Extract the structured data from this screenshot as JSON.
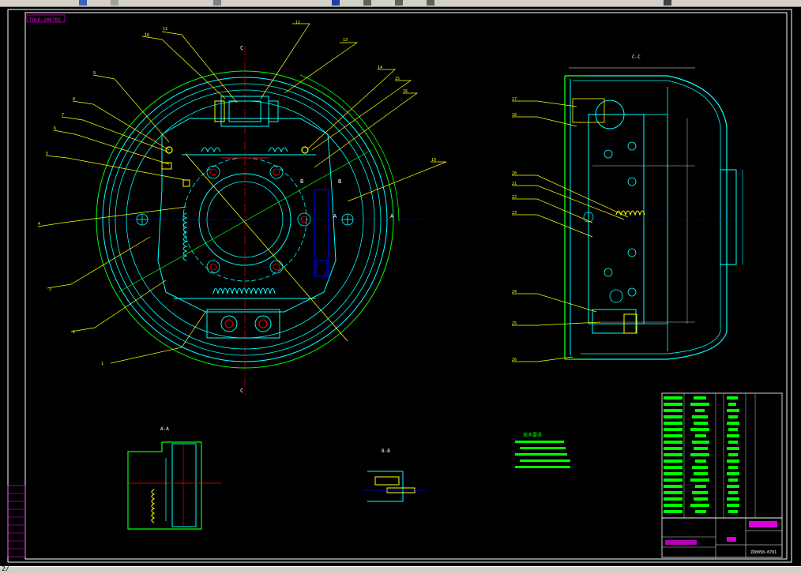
{
  "drawing": {
    "sheet_code": "TOLE-200702",
    "view_labels": {
      "section_cc": "C-C",
      "section_aa": "A-A",
      "section_bb": "B-B"
    },
    "section_marks": [
      "A",
      "A",
      "B",
      "B",
      "C",
      "C"
    ],
    "callouts_front": [
      "1",
      "2",
      "3",
      "4",
      "5",
      "6",
      "7",
      "8",
      "9",
      "10",
      "11",
      "12",
      "13",
      "14",
      "15",
      "16",
      "19"
    ],
    "callouts_side": [
      "17",
      "18",
      "20",
      "21",
      "22",
      "23",
      "24",
      "25",
      "26"
    ],
    "tech_req_title": "技术要求",
    "title_block_drawing_no": "ZD0050-0701"
  },
  "colors": {
    "background": "#000000",
    "green": "#00ff00",
    "cyan": "#00ffff",
    "yellow": "#ffff00",
    "white": "#ffffff",
    "red": "#ff0000",
    "blue": "#0000ff",
    "magenta": "#ff00ff"
  },
  "status": {
    "coords": "2/"
  }
}
